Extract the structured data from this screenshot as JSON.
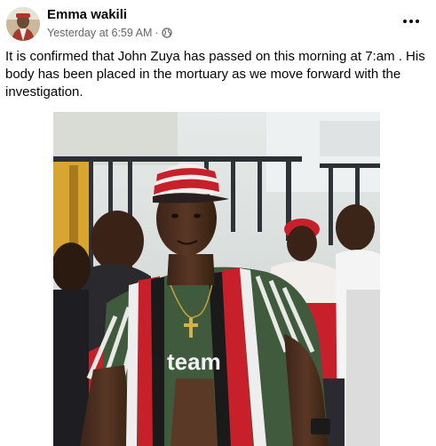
{
  "post": {
    "author": "Emma wakili",
    "timestamp": "Yesterday at 6:59 AM",
    "separator": "·",
    "audience_icon": "globe-icon",
    "more_icon": "more-options-icon",
    "text": "It is confirmed that John Zuya has passed on this morning at 7:am . His body has been placed in the mortuary as we move forward with the investigation."
  },
  "photo": {
    "shirt_text": "team"
  },
  "colors": {
    "author_text": "#050505",
    "meta_text": "#65676b",
    "scarf_red": "#c8202a",
    "shirt_green": "#3f5a3c"
  }
}
